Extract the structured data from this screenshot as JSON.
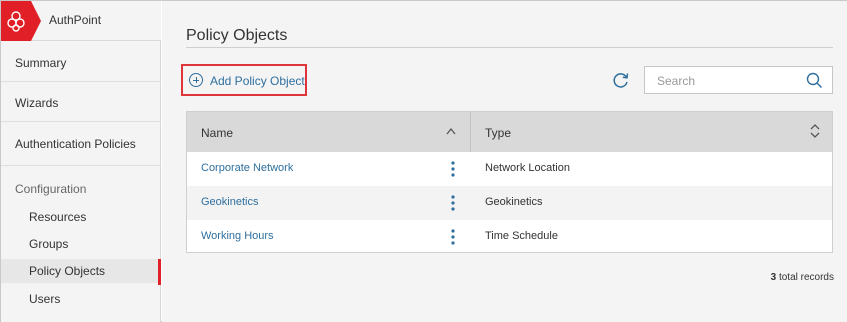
{
  "app": {
    "name": "AuthPoint",
    "brand_color": "#e01f26"
  },
  "sidebar": {
    "items": [
      {
        "label": "Summary"
      },
      {
        "label": "Wizards"
      },
      {
        "label": "Authentication Policies"
      }
    ],
    "section_label": "Configuration",
    "sub_items": [
      {
        "label": "Resources"
      },
      {
        "label": "Groups"
      },
      {
        "label": "Policy Objects",
        "active": true
      },
      {
        "label": "Users"
      }
    ]
  },
  "main": {
    "title": "Policy Objects",
    "add_button_label": "Add Policy Object",
    "search_placeholder": "Search",
    "table": {
      "columns": [
        "Name",
        "Type"
      ],
      "rows": [
        {
          "name": "Corporate Network",
          "type": "Network Location"
        },
        {
          "name": "Geokinetics",
          "type": "Geokinetics"
        },
        {
          "name": "Working Hours",
          "type": "Time Schedule"
        }
      ]
    },
    "records_count": "3",
    "records_label": "total records"
  },
  "colors": {
    "link": "#2f6f9e",
    "highlight_border": "#e0343b",
    "active_indicator": "#e01f26"
  },
  "icons": [
    "authpoint-logo-icon",
    "plus-circle-icon",
    "refresh-icon",
    "search-icon",
    "sort-asc-icon",
    "sort-icon",
    "more-vertical-icon"
  ]
}
